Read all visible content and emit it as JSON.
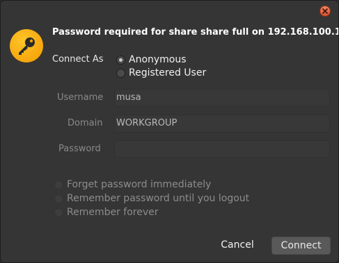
{
  "dialog": {
    "heading": "Password required for share share full on 192.168.100.1",
    "connect_as_label": "Connect As",
    "connect_as_options": [
      {
        "label": "Anonymous",
        "checked": true
      },
      {
        "label": "Registered User",
        "checked": false
      }
    ],
    "fields": {
      "username_label": "Username",
      "username_value": "musa",
      "domain_label": "Domain",
      "domain_value": "WORKGROUP",
      "password_label": "Password",
      "password_value": ""
    },
    "remember_options": [
      {
        "label": "Forget password immediately",
        "checked": false
      },
      {
        "label": "Remember password until you logout",
        "checked": false
      },
      {
        "label": "Remember forever",
        "checked": false
      }
    ],
    "buttons": {
      "cancel": "Cancel",
      "connect": "Connect"
    }
  },
  "icons": {
    "app": "key-icon",
    "close": "close-icon"
  },
  "colors": {
    "background": "#353535",
    "icon_orange": "#f5a300",
    "close_red": "#e2622f"
  }
}
